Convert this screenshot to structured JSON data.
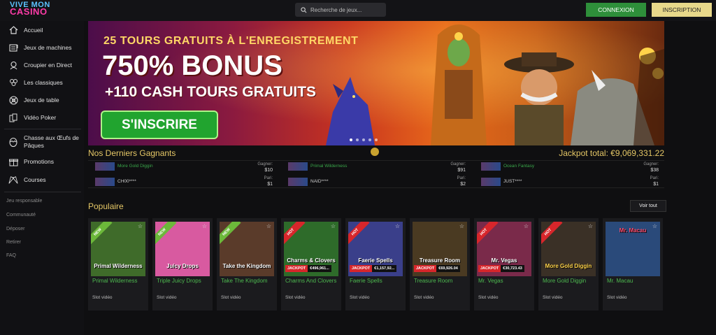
{
  "brand": {
    "line1": "VIVE MON",
    "line2": "CASINO"
  },
  "search": {
    "placeholder": "Recherche de jeux..."
  },
  "auth": {
    "login_label": "CONNEXION",
    "signup_label": "INSCRIPTION"
  },
  "sidebar": {
    "items": [
      {
        "label": "Accueil",
        "icon": "home-icon"
      },
      {
        "label": "Jeux de machines",
        "icon": "slot-machine-icon"
      },
      {
        "label": "Croupier en Direct",
        "icon": "dealer-icon"
      },
      {
        "label": "Les classiques",
        "icon": "clover-icon"
      },
      {
        "label": "Jeux de table",
        "icon": "roulette-icon"
      },
      {
        "label": "Vidéo Poker",
        "icon": "cards-icon"
      },
      {
        "label": "Chasse aux Œufs de Pâques",
        "icon": "egg-icon"
      },
      {
        "label": "Promotions",
        "icon": "gift-icon"
      },
      {
        "label": "Courses",
        "icon": "race-flag-icon"
      }
    ],
    "links": [
      "Jeu responsable",
      "Communauté",
      "Déposer",
      "Retirer",
      "FAQ"
    ]
  },
  "banner": {
    "line1": "25 TOURS GRATUITS À L'ENREGISTREMENT",
    "line2": "750% BONUS",
    "line3": "+110 CASH TOURS GRATUITS",
    "cta": "S'INSCRIRE",
    "slides": 5,
    "active_slide": 1
  },
  "winners": {
    "title": "Nos Derniers Gagnants",
    "jackpot_text": "Jackpot total: €9,069,331.22",
    "cols": [
      {
        "game": "More Gold Diggin",
        "gain_label": "Gagner:",
        "gain": "$10",
        "player": "CH00****",
        "bet_label": "Pari:",
        "bet": "$1"
      },
      {
        "game": "Primal Wilderness",
        "gain_label": "Gagner:",
        "gain": "$91",
        "player": "NAID****",
        "bet_label": "Pari:",
        "bet": "$2"
      },
      {
        "game": "Ocean Fantasy",
        "gain_label": "Gagner:",
        "gain": "$38",
        "player": "JUST****",
        "bet_label": "Pari:",
        "bet": "$1"
      }
    ]
  },
  "popular": {
    "title": "Populaire",
    "see_all": "Voir tout",
    "games": [
      {
        "name": "Primal Wilderness",
        "type": "Slot vidéo",
        "badge": "NEW",
        "art": "Primal Wilderness",
        "bg": "#3f6b2a",
        "jackpot": ""
      },
      {
        "name": "Triple Juicy Drops",
        "type": "Slot vidéo",
        "badge": "NEW",
        "art": "Juicy Drops",
        "bg": "#d85aa0",
        "jackpot": ""
      },
      {
        "name": "Take The Kingdom",
        "type": "Slot vidéo",
        "badge": "NEW",
        "art": "Take the Kingdom",
        "bg": "#5a3b2a",
        "jackpot": ""
      },
      {
        "name": "Charms And Clovers",
        "type": "Slot vidéo",
        "badge": "HOT",
        "art": "Charms & Clovers",
        "bg": "#2e6b2a",
        "jackpot": "€496,961..."
      },
      {
        "name": "Faerie Spells",
        "type": "Slot vidéo",
        "badge": "HOT",
        "art": "Faerie Spells",
        "bg": "#3a3f8a",
        "jackpot": "€1,157,92..."
      },
      {
        "name": "Treasure Room",
        "type": "Slot vidéo",
        "badge": "",
        "art": "Treasure Room",
        "bg": "#4a3a22",
        "jackpot": "€69,926.04"
      },
      {
        "name": "Mr. Vegas",
        "type": "Slot vidéo",
        "badge": "HOT",
        "art": "Mr. Vegas",
        "bg": "#7a2a4a",
        "jackpot": "€30,723.43"
      },
      {
        "name": "More Gold Diggin",
        "type": "Slot vidéo",
        "badge": "HOT",
        "art": "More Gold Diggin",
        "bg": "#3a3026",
        "jackpot": ""
      },
      {
        "name": "Mr. Macau",
        "type": "Slot vidéo",
        "badge": "",
        "art": "Mr. Macau",
        "bg": "#2a4a7a",
        "jackpot": ""
      }
    ],
    "jackpot_label": "JACKPOT"
  }
}
